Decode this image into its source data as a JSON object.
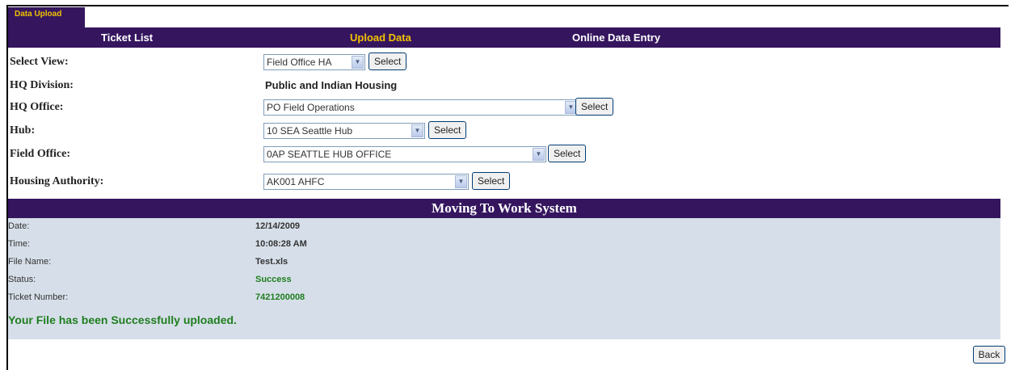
{
  "tab": {
    "label": "Data Upload"
  },
  "nav": {
    "items": [
      {
        "label": "Ticket List"
      },
      {
        "label": "Upload Data"
      },
      {
        "label": "Online Data Entry"
      }
    ]
  },
  "form": {
    "select_view": {
      "label": "Select View:",
      "value": "Field Office HA",
      "button": "Select"
    },
    "hq_division": {
      "label": "HQ Division:",
      "value": "Public and Indian Housing"
    },
    "hq_office": {
      "label": "HQ Office:",
      "value": "PO Field Operations",
      "button": "Select"
    },
    "hub": {
      "label": "Hub:",
      "value": "10 SEA Seattle Hub",
      "button": "Select"
    },
    "field_office": {
      "label": "Field Office:",
      "value": "0AP SEATTLE HUB OFFICE",
      "button": "Select"
    },
    "housing_authority": {
      "label": "Housing Authority:",
      "value": "AK001 AHFC",
      "button": "Select"
    }
  },
  "panel": {
    "title": "Moving To Work System",
    "rows": [
      {
        "label": "Date:",
        "value": "12/14/2009"
      },
      {
        "label": "Time:",
        "value": "10:08:28 AM"
      },
      {
        "label": "File Name:",
        "value": "Test.xls"
      },
      {
        "label": "Status:",
        "value": "Success"
      },
      {
        "label": "Ticket Number:",
        "value": "7421200008"
      }
    ],
    "message": "Your File has been Successfully uploaded."
  },
  "back_button": "Back",
  "colors": {
    "brand": "#35165e",
    "accent": "#f2c200",
    "panel": "#d6dfe9",
    "success": "#1f7d1f"
  }
}
